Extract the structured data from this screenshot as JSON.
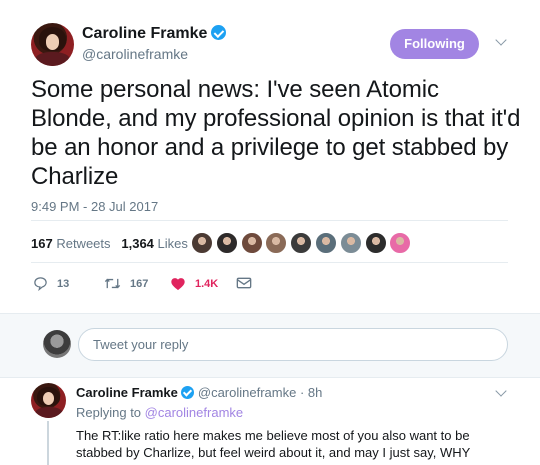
{
  "tweet": {
    "author_name": "Caroline Framke",
    "author_handle": "@carolineframke",
    "follow_label": "Following",
    "text": "Some personal news: I've seen Atomic Blonde, and my professional opinion is that it'd be an honor and a privilege to get stabbed by Charlize",
    "timestamp": "9:49 PM - 28 Jul 2017",
    "retweets_count": "167",
    "retweets_label": "Retweets",
    "likes_count": "1,364",
    "likes_label": "Likes",
    "likers": [
      "#4b3a33",
      "#2d2a2a",
      "#6e4a3c",
      "#8a6a57",
      "#3b3b3b",
      "#5a6e7a",
      "#7b8c96",
      "#2c2c2c",
      "#e86aa7"
    ],
    "actions": {
      "reply_count": "13",
      "retweet_count": "167",
      "like_count": "1.4K"
    }
  },
  "reply_box": {
    "placeholder": "Tweet your reply"
  },
  "reply": {
    "author_name": "Caroline Framke",
    "author_handle": "@carolineframke",
    "time": "· 8h",
    "replying_prefix": "Replying to",
    "replying_handle": "@carolineframke",
    "text": "The RT:like ratio here makes me believe most of you also want to be stabbed by Charlize, but feel weird about it, and may I just say, WHY"
  },
  "colors": {
    "accent": "#a285e3",
    "verified": "#1da1f2",
    "like": "#e0245e",
    "muted": "#657786"
  }
}
